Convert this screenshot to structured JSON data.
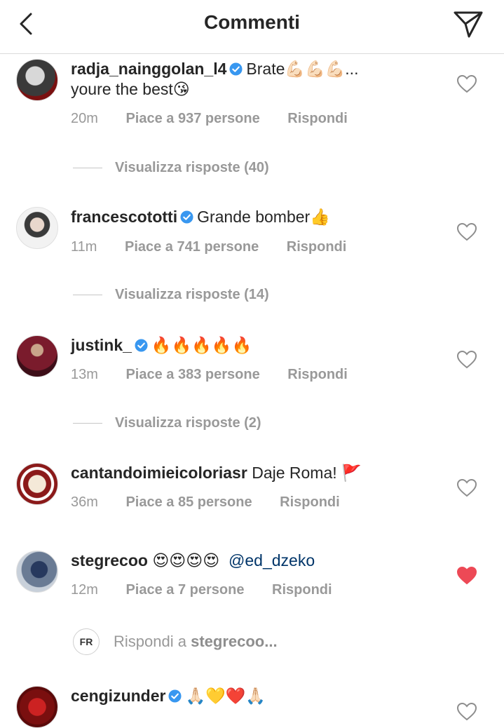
{
  "header": {
    "title": "Commenti",
    "back_icon": "chevron-left-icon",
    "send_icon": "paper-plane-icon"
  },
  "comments": [
    {
      "username": "radja_nainggolan_l4",
      "verified": true,
      "text_line1": "Brate💪🏻💪🏻💪🏻...",
      "text_line2": "youre the best😘",
      "time": "20m",
      "likes": "Piace a 937 persone",
      "reply": "Rispondi",
      "liked": false,
      "view_replies": "Visualizza risposte (40)"
    },
    {
      "username": "francescototti",
      "verified": true,
      "text": "Grande bomber👍",
      "time": "11m",
      "likes": "Piace a 741 persone",
      "reply": "Rispondi",
      "liked": false,
      "view_replies": "Visualizza risposte (14)"
    },
    {
      "username": "justink_",
      "verified": true,
      "text": "🔥🔥🔥🔥🔥",
      "time": "13m",
      "likes": "Piace a 383 persone",
      "reply": "Rispondi",
      "liked": false,
      "view_replies": "Visualizza risposte (2)"
    },
    {
      "username": "cantandoimieicoloriasr",
      "verified": false,
      "text": "Daje Roma! 🚩",
      "time": "36m",
      "likes": "Piace a 85 persone",
      "reply": "Rispondi",
      "liked": false
    },
    {
      "username": "stegrecoo",
      "verified": false,
      "text": "😍😍😍😍",
      "mention": "@ed_dzeko",
      "time": "12m",
      "likes": "Piace a 7 persone",
      "reply": "Rispondi",
      "liked": true
    },
    {
      "username": "cengizunder",
      "verified": true,
      "text": "🙏🏻💛❤️🙏🏻",
      "liked": false
    }
  ],
  "reply_input": {
    "avatar_text": "FR",
    "prefix": "Rispondi a",
    "target": "stegrecoo..."
  },
  "colors": {
    "verified": "#3897f0",
    "liked_heart": "#ed4956",
    "meta_text": "#999999",
    "mention": "#003569"
  }
}
